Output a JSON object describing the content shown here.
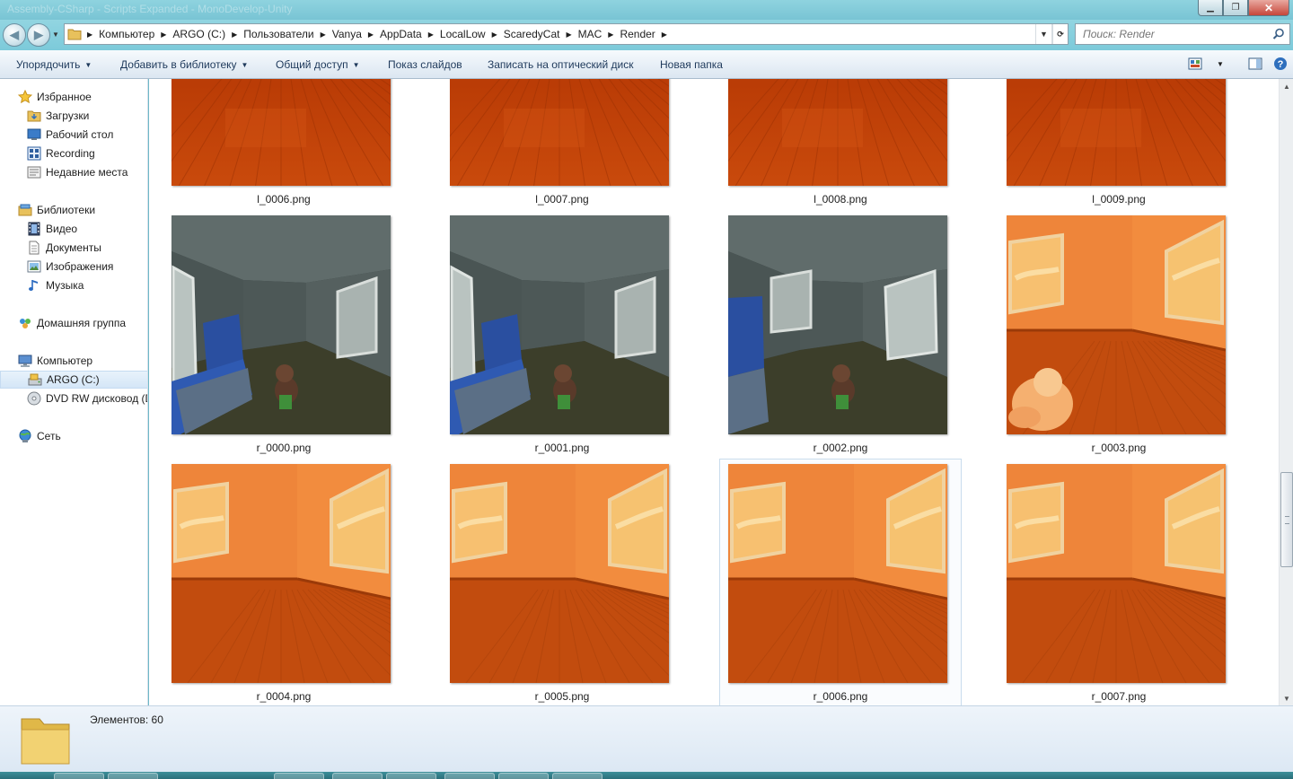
{
  "window": {
    "title": "Assembly-CSharp - Scripts Expanded - MonoDevelop-Unity"
  },
  "address": {
    "crumbs": [
      "Компьютер",
      "ARGO (C:)",
      "Пользователи",
      "Vanya",
      "AppData",
      "LocalLow",
      "ScaredyCat",
      "MAC",
      "Render"
    ]
  },
  "search": {
    "placeholder": "Поиск: Render"
  },
  "toolbar": {
    "organize": "Упорядочить",
    "add_library": "Добавить в библиотеку",
    "share": "Общий доступ",
    "slideshow": "Показ слайдов",
    "burn": "Записать на оптический диск",
    "new_folder": "Новая папка"
  },
  "nav": {
    "favorites": "Избранное",
    "downloads": "Загрузки",
    "desktop": "Рабочий стол",
    "recording": "Recording",
    "recent": "Недавние места",
    "libraries": "Библиотеки",
    "video": "Видео",
    "documents": "Документы",
    "images": "Изображения",
    "music": "Музыка",
    "homegroup": "Домашняя группа",
    "computer": "Компьютер",
    "drive_c": "ARGO (C:)",
    "dvd": "DVD RW дисковод (D",
    "network": "Сеть"
  },
  "files": [
    {
      "name": "l_0006.png",
      "kind": "floor"
    },
    {
      "name": "l_0007.png",
      "kind": "floor"
    },
    {
      "name": "l_0008.png",
      "kind": "floor"
    },
    {
      "name": "l_0009.png",
      "kind": "floor"
    },
    {
      "name": "r_0000.png",
      "kind": "dark"
    },
    {
      "name": "r_0001.png",
      "kind": "dark"
    },
    {
      "name": "r_0002.png",
      "kind": "dark2"
    },
    {
      "name": "r_0003.png",
      "kind": "orange-cat"
    },
    {
      "name": "r_0004.png",
      "kind": "orange"
    },
    {
      "name": "r_0005.png",
      "kind": "orange"
    },
    {
      "name": "r_0006.png",
      "kind": "orange",
      "selected": true
    },
    {
      "name": "r_0007.png",
      "kind": "orange"
    }
  ],
  "details": {
    "count": "Элементов: 60"
  }
}
